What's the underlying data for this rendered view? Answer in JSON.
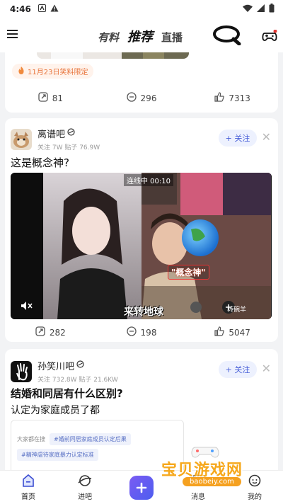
{
  "status_bar": {
    "time": "4:46"
  },
  "top_nav": {
    "tabs": [
      {
        "label": "有料"
      },
      {
        "label": "推荐"
      },
      {
        "label": "直播"
      }
    ]
  },
  "feed": {
    "prev_post": {
      "pill": "11月23日笑料限定",
      "stats": {
        "shares": "81",
        "comments": "296",
        "likes": "7313"
      }
    },
    "post1": {
      "user": "离谱吧",
      "meta": "关注 7W   贴子 76.9W",
      "follow_label": "+ 关注",
      "title": "这是概念神?",
      "video": {
        "live_badge": "连线中 00:10",
        "caption_red": "\"概念神\"",
        "caption_main": "来转地球",
        "streamer": "转碗羊"
      },
      "stats": {
        "shares": "282",
        "comments": "198",
        "likes": "5047"
      }
    },
    "post2": {
      "user": "孙笑川吧",
      "meta": "关注 732.8W   贴子 21.6KW",
      "follow_label": "+ 关注",
      "title": "结婚和同居有什么区别?",
      "subtitle": "认定为家庭成员了都",
      "quote": {
        "label": "大家都在搜",
        "tag1": "#婚前同居家庭成员认定后果",
        "tag2": "#精神虐待家庭暴力认定标准"
      }
    }
  },
  "bottom_bar": {
    "items": [
      {
        "label": "首页"
      },
      {
        "label": "进吧"
      },
      {
        "label": ""
      },
      {
        "label": "消息"
      },
      {
        "label": "我的"
      }
    ]
  },
  "watermark": {
    "text": "宝贝游戏网",
    "url": "baobeiy.com"
  },
  "colors": {
    "accent": "#4960d8",
    "publish": "#6a5cf2",
    "fire": "#e8743b"
  }
}
